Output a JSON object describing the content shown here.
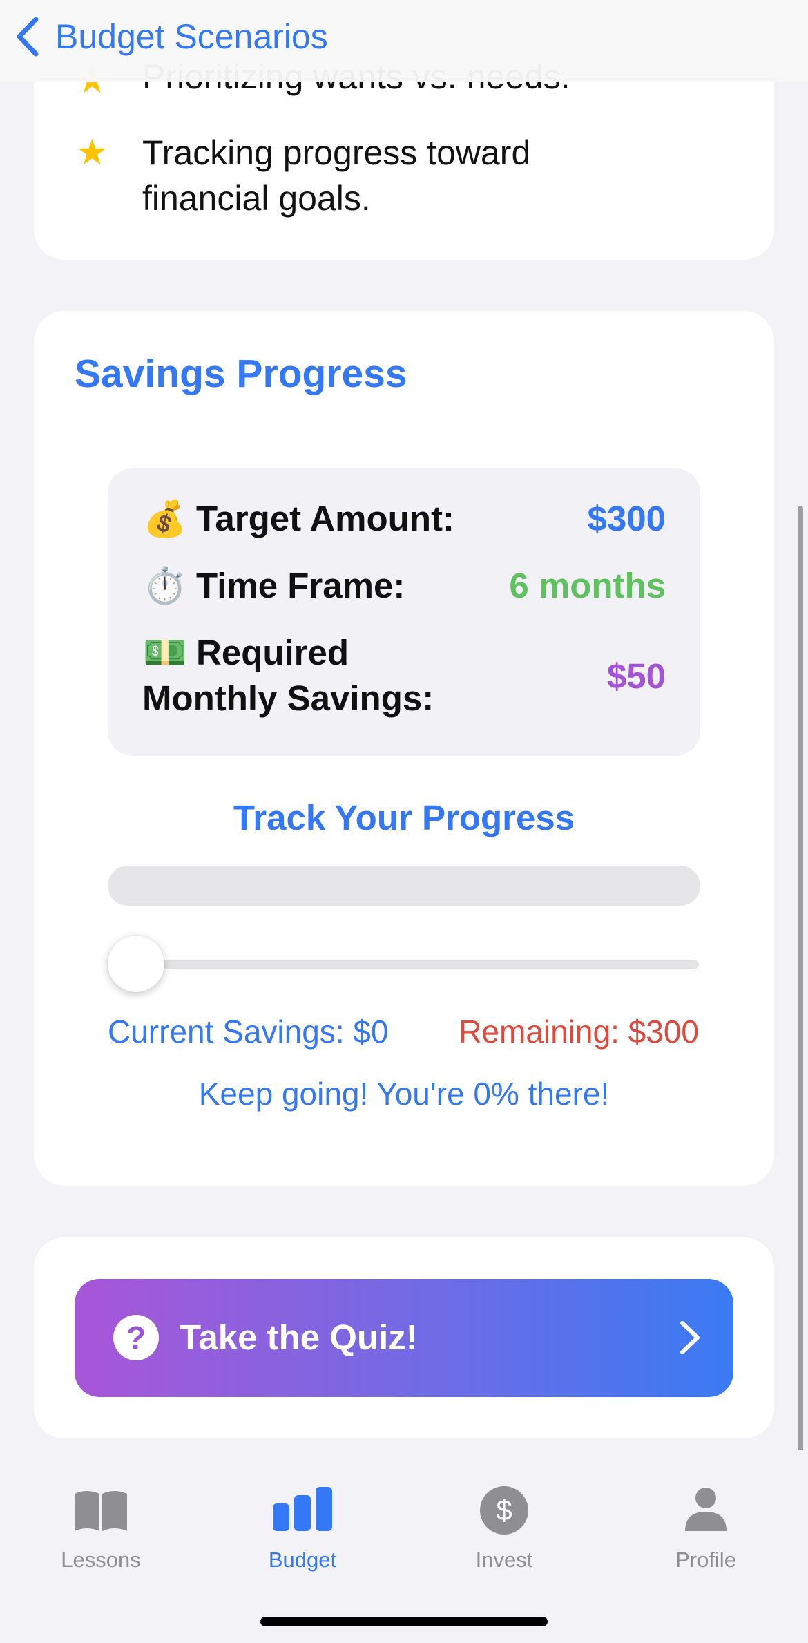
{
  "nav": {
    "back_label": "Budget Scenarios"
  },
  "list_card": {
    "items": [
      {
        "icon": "star-icon",
        "text": "Prioritizing wants vs. needs."
      },
      {
        "icon": "star-icon",
        "text": "Tracking progress toward financial goals."
      }
    ]
  },
  "savings": {
    "title": "Savings Progress",
    "rows": [
      {
        "emoji": "💰",
        "label": "Target Amount:",
        "value": "$300",
        "color": "#3478f6"
      },
      {
        "emoji": "⏱️",
        "label": "Time Frame:",
        "value": "6 months",
        "color": "#5fc15f"
      },
      {
        "emoji": "💵",
        "label": "Required Monthly Savings:",
        "value": "$50",
        "color": "#a353d6"
      }
    ],
    "track_title": "Track Your Progress",
    "progress_fraction": 0,
    "slider_fraction": 0,
    "current_savings": "Current Savings: $0",
    "remaining": "Remaining: $300",
    "encouragement": "Keep going! You're 0% there!"
  },
  "quiz": {
    "label": "Take the Quiz!",
    "icon": "question-mark-icon",
    "chevron": "chevron-right-icon"
  },
  "tabs": [
    {
      "label": "Lessons",
      "icon": "book-icon",
      "active": false
    },
    {
      "label": "Budget",
      "icon": "bar-chart-icon",
      "active": true
    },
    {
      "label": "Invest",
      "icon": "dollar-circle-icon",
      "active": false
    },
    {
      "label": "Profile",
      "icon": "person-icon",
      "active": false
    }
  ],
  "colors": {
    "accent": "#3478f6",
    "remaining": "#e0483a",
    "inactive_tab": "#8e8e93"
  }
}
